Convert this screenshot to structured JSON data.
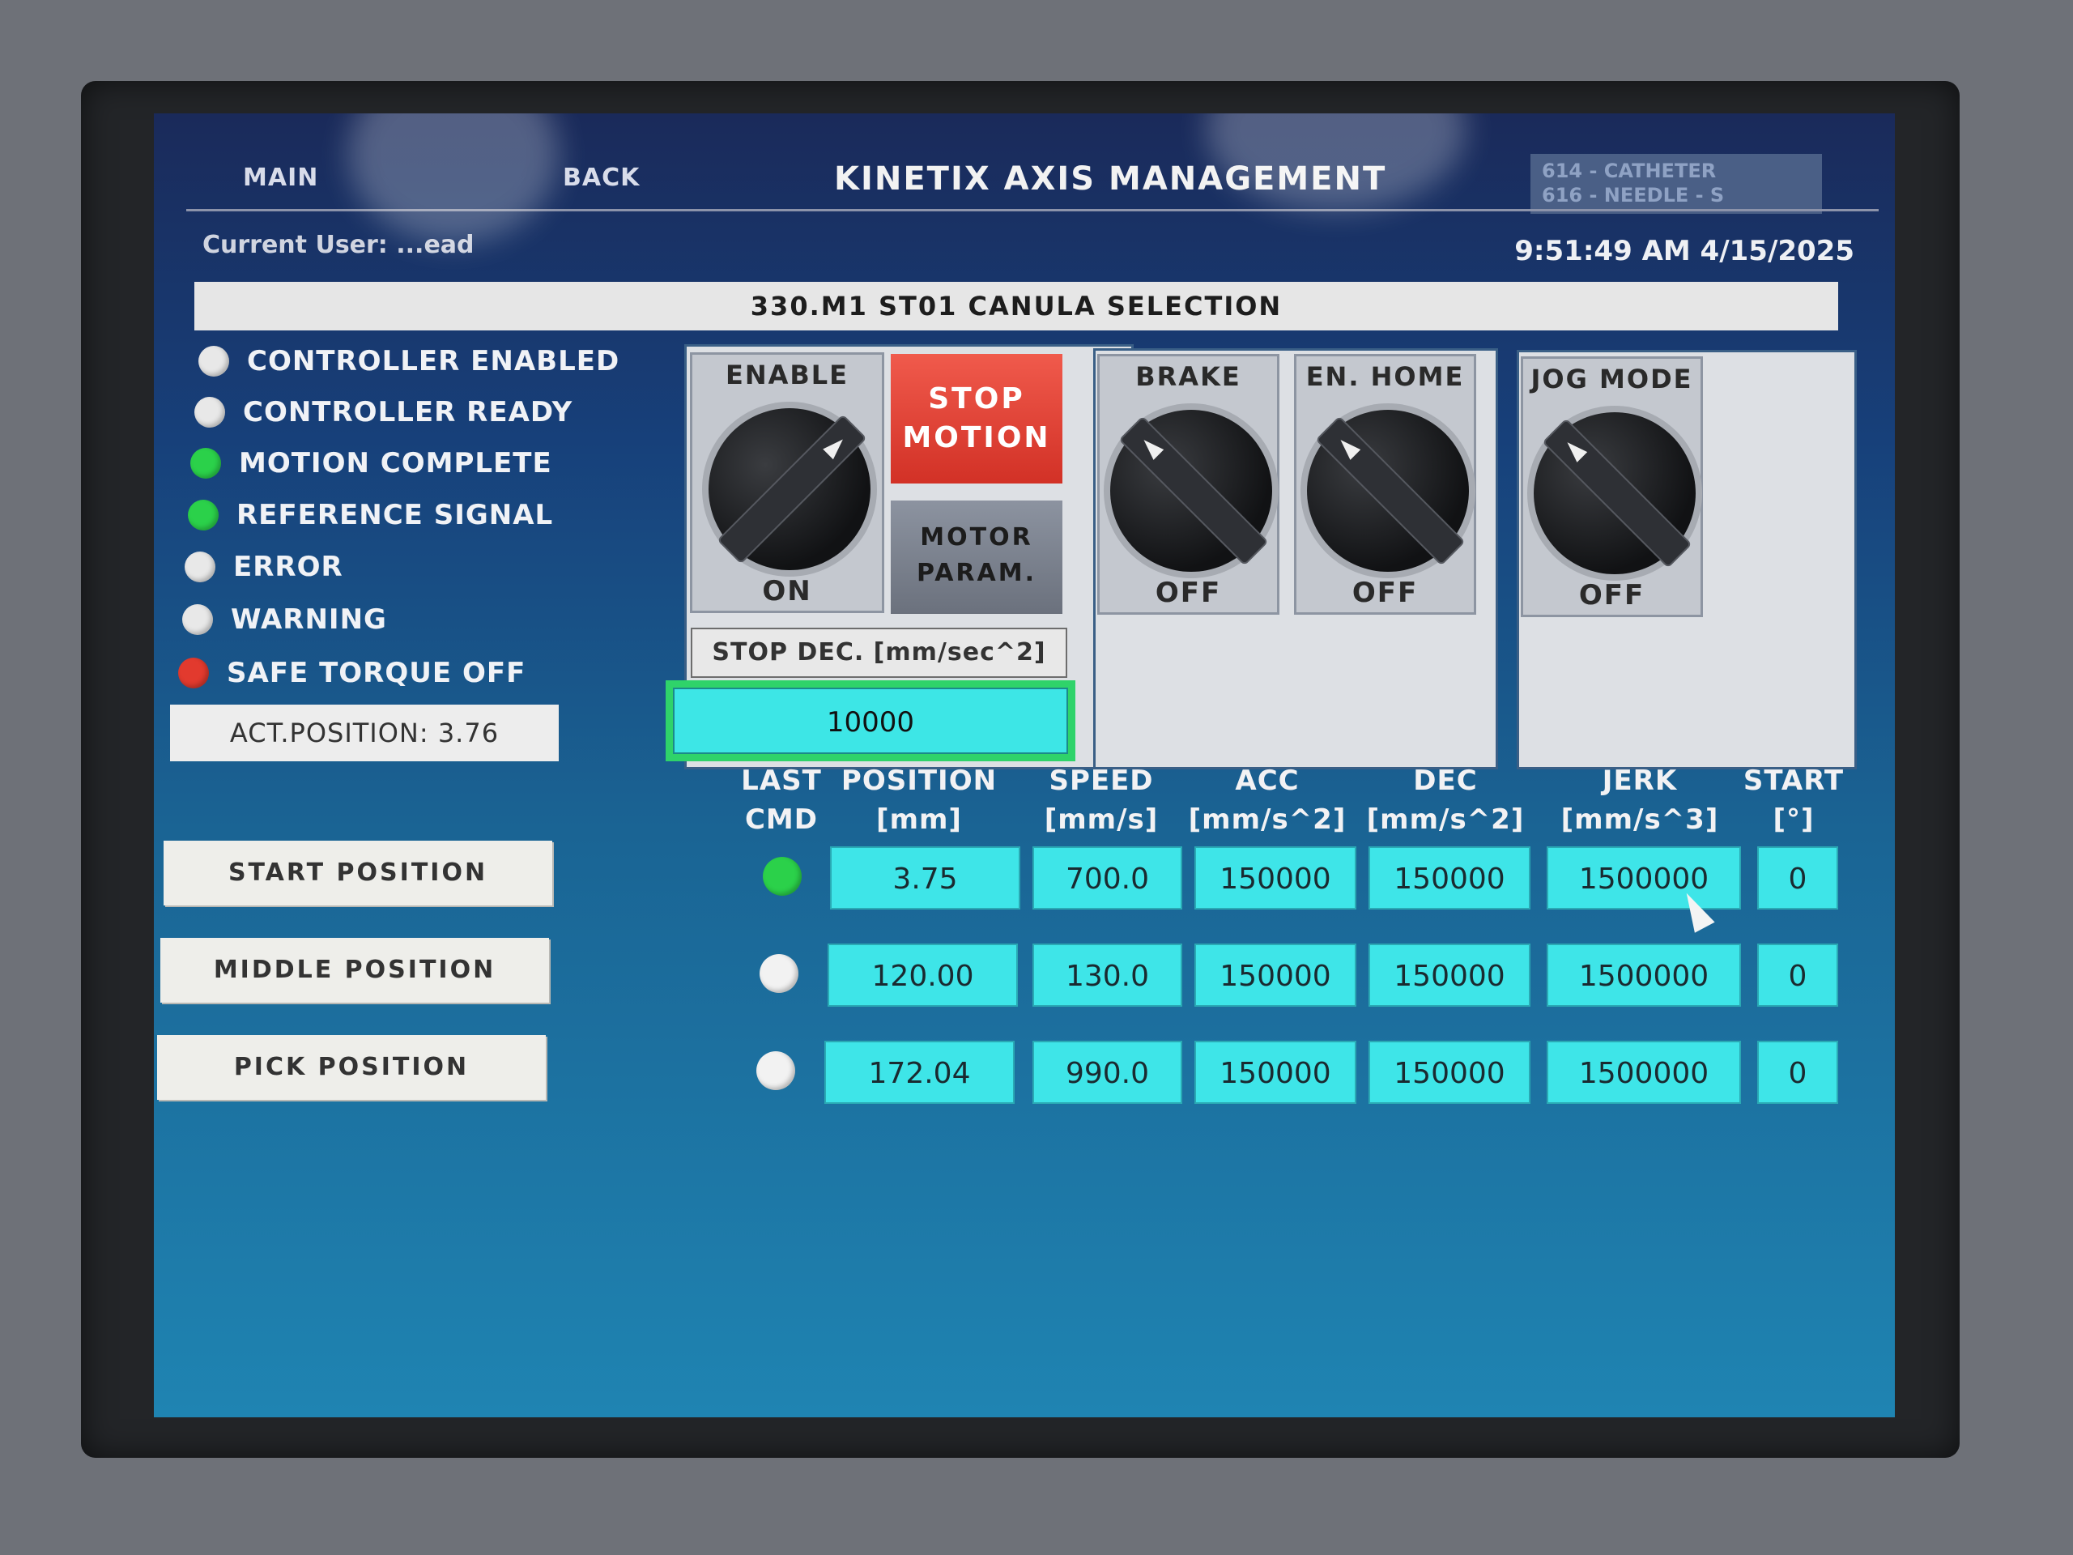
{
  "header": {
    "nav_main": "MAIN",
    "nav_back": "BACK",
    "title": "KINETIX AXIS MANAGEMENT",
    "station_lines": [
      "614 - CATHETER",
      "616 - NEEDLE - S"
    ],
    "current_user_label": "Current User: ...ead",
    "clock": "9:51:49 AM 4/15/2025"
  },
  "section_title": "330.M1 ST01 CANULA SELECTION",
  "status_indicators": [
    {
      "label": "CONTROLLER ENABLED",
      "color": "#e8e8e8"
    },
    {
      "label": "CONTROLLER READY",
      "color": "#e8e8e8"
    },
    {
      "label": "MOTION COMPLETE",
      "color": "#2bd14a"
    },
    {
      "label": "REFERENCE SIGNAL",
      "color": "#2bd14a"
    },
    {
      "label": "ERROR",
      "color": "#e8e8e8"
    },
    {
      "label": "WARNING",
      "color": "#e8e8e8"
    },
    {
      "label": "SAFE TORQUE OFF",
      "color": "#e23a2e"
    }
  ],
  "act_position": "ACT.POSITION: 3.76",
  "selectors": {
    "enable": {
      "title": "ENABLE",
      "state": "ON"
    },
    "brake": {
      "title": "BRAKE",
      "state": "OFF"
    },
    "en_home": {
      "title": "EN. HOME",
      "state": "OFF"
    },
    "jog_mode": {
      "title": "JOG MODE",
      "state": "OFF"
    }
  },
  "stop_motion": [
    "STOP",
    "MOTION"
  ],
  "motor_param": [
    "MOTOR",
    "PARAM."
  ],
  "stop_dec": {
    "label": "STOP DEC. [mm/sec^2]",
    "value": "10000"
  },
  "table": {
    "headers": [
      [
        "LAST",
        "CMD"
      ],
      [
        "POSITION",
        "[mm]"
      ],
      [
        "SPEED",
        "[mm/s]"
      ],
      [
        "ACC",
        "[mm/s^2]"
      ],
      [
        "DEC",
        "[mm/s^2]"
      ],
      [
        "JERK",
        "[mm/s^3]"
      ],
      [
        "START",
        "[°]"
      ]
    ],
    "rows": [
      {
        "button": "START POSITION",
        "last_cmd_color": "#2bd14a",
        "position": "3.75",
        "speed": "700.0",
        "acc": "150000",
        "dec": "150000",
        "jerk": "1500000",
        "start": "0"
      },
      {
        "button": "MIDDLE POSITION",
        "last_cmd_color": "#f2f2f2",
        "position": "120.00",
        "speed": "130.0",
        "acc": "150000",
        "dec": "150000",
        "jerk": "1500000",
        "start": "0"
      },
      {
        "button": "PICK POSITION",
        "last_cmd_color": "#f2f2f2",
        "position": "172.04",
        "speed": "990.0",
        "acc": "150000",
        "dec": "150000",
        "jerk": "1500000",
        "start": "0"
      }
    ]
  }
}
